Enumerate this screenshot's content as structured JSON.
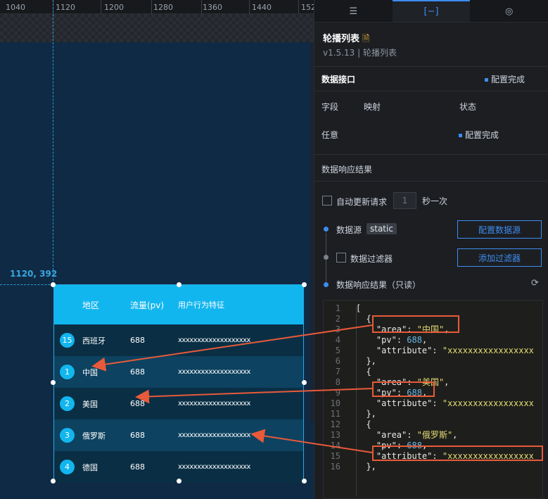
{
  "ruler": {
    "ticks": [
      "1040",
      "1120",
      "1200",
      "1280",
      "1360",
      "1440",
      "152"
    ]
  },
  "canvas": {
    "coord_label": "1120, 392"
  },
  "widget": {
    "headers": [
      "地区",
      "流量(pv)",
      "用户行为特征"
    ],
    "rows": [
      {
        "rank": "15",
        "area": "西班牙",
        "pv": "688",
        "attribute": "xxxxxxxxxxxxxxxxxxx"
      },
      {
        "rank": "1",
        "area": "中国",
        "pv": "688",
        "attribute": "xxxxxxxxxxxxxxxxxxx"
      },
      {
        "rank": "2",
        "area": "美国",
        "pv": "688",
        "attribute": "xxxxxxxxxxxxxxxxxxx"
      },
      {
        "rank": "3",
        "area": "俄罗斯",
        "pv": "688",
        "attribute": "xxxxxxxxxxxxxxxxxxx"
      },
      {
        "rank": "4",
        "area": "德国",
        "pv": "688",
        "attribute": "xxxxxxxxxxxxxxxxxxx"
      }
    ]
  },
  "panel": {
    "tabs": [
      "☰",
      "[−]",
      "◎"
    ],
    "title": "轮播列表",
    "version": "v1.5.13 | 轮播列表",
    "data_api": {
      "label": "数据接口",
      "status": "配置完成"
    },
    "table_headers": {
      "field": "字段",
      "mapping": "映射",
      "status": "状态"
    },
    "field_row": {
      "field": "任意",
      "status": "配置完成"
    },
    "response_label": "数据响应结果",
    "auto_update": {
      "label": "自动更新请求",
      "value": "1",
      "unit": "秒一次"
    },
    "datasource": {
      "label": "数据源",
      "tag": "static",
      "button": "配置数据源"
    },
    "filter": {
      "label": "数据过滤器",
      "button": "添加过滤器"
    },
    "readonly_label": "数据响应结果（只读）"
  },
  "editor": {
    "lines": [
      {
        "n": "1",
        "t": "["
      },
      {
        "n": "2",
        "t": "  {"
      },
      {
        "n": "3",
        "k": "\"area\"",
        "v": "\"中国\"",
        "vt": "str",
        "tail": ","
      },
      {
        "n": "4",
        "k": "\"pv\"",
        "v": "688",
        "vt": "num",
        "tail": ","
      },
      {
        "n": "5",
        "k": "\"attribute\"",
        "v": "\"xxxxxxxxxxxxxxxxx",
        "vt": "str",
        "tail": ""
      },
      {
        "n": "6",
        "t": "  },"
      },
      {
        "n": "7",
        "t": "  {"
      },
      {
        "n": "8",
        "k": "\"area\"",
        "v": "\"美国\"",
        "vt": "str",
        "tail": ","
      },
      {
        "n": "9",
        "k": "\"pv\"",
        "v": "688",
        "vt": "num",
        "tail": ","
      },
      {
        "n": "10",
        "k": "\"attribute\"",
        "v": "\"xxxxxxxxxxxxxxxxx",
        "vt": "str",
        "tail": ""
      },
      {
        "n": "11",
        "t": "  },"
      },
      {
        "n": "12",
        "t": "  {"
      },
      {
        "n": "13",
        "k": "\"area\"",
        "v": "\"俄罗斯\"",
        "vt": "str",
        "tail": ","
      },
      {
        "n": "14",
        "k": "\"pv\"",
        "v": "688",
        "vt": "num",
        "tail": ","
      },
      {
        "n": "15",
        "k": "\"attribute\"",
        "v": "\"xxxxxxxxxxxxxxxxx",
        "vt": "str",
        "tail": ""
      },
      {
        "n": "16",
        "t": "  },"
      }
    ]
  },
  "colors": {
    "accent": "#3d8cf0",
    "widget_header": "#12b6ef",
    "annotation": "#e85a3a"
  }
}
